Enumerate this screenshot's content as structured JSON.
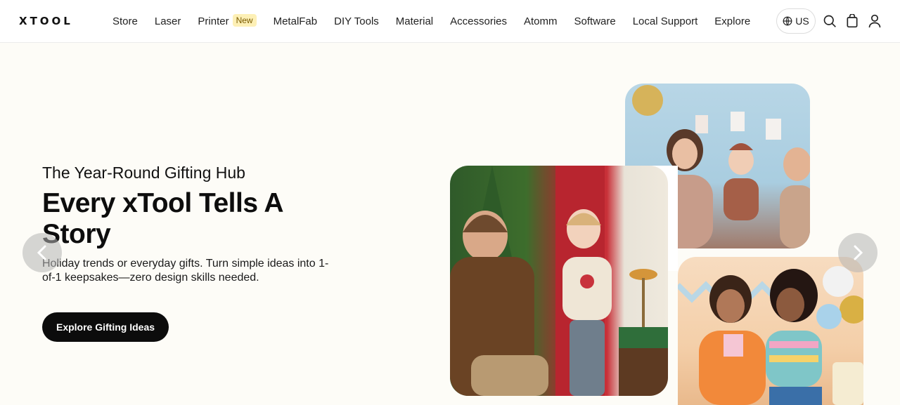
{
  "header": {
    "logo_text": "XTOOL",
    "nav": [
      {
        "label": "Store"
      },
      {
        "label": "Laser"
      },
      {
        "label": "Printer",
        "badge": "New"
      },
      {
        "label": "MetalFab"
      },
      {
        "label": "DIY Tools"
      },
      {
        "label": "Material"
      },
      {
        "label": "Accessories"
      },
      {
        "label": "Atomm"
      },
      {
        "label": "Software"
      },
      {
        "label": "Local Support"
      },
      {
        "label": "Explore"
      }
    ],
    "region": "US",
    "icons": [
      "globe-icon",
      "search-icon",
      "bag-icon",
      "user-icon"
    ]
  },
  "hero": {
    "eyebrow": "The Year-Round Gifting Hub",
    "headline": "Every xTool Tells A Story",
    "description": "Holiday trends or everyday gifts. Turn simple ideas into 1-of-1 keepsakes—zero design skills needed.",
    "cta_label": "Explore Gifting Ideas",
    "prev_icon": "chevron-left-icon",
    "next_icon": "chevron-right-icon"
  },
  "colors": {
    "page_bg": "#fdfcf7",
    "cta_bg": "#0c0c0c",
    "badge_bg": "#fdf0b6"
  }
}
